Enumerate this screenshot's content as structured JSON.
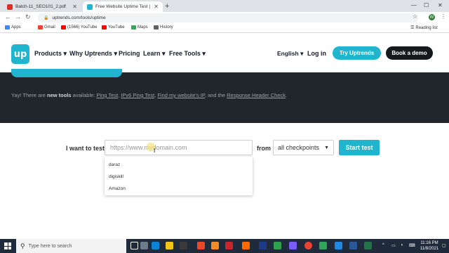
{
  "browser": {
    "tabs": [
      {
        "title": "Batch-11_SEO101_2.pdf",
        "active": false,
        "favicon_color": "#d93025"
      },
      {
        "title": "Free Website Uptime Test | Uptr",
        "active": true,
        "favicon_color": "#1fb5cf"
      }
    ],
    "url": "uptrends.com/tools/uptime",
    "profile_initial": "W",
    "bookmarks": [
      {
        "label": "Apps",
        "icon_color": "#4285f4"
      },
      {
        "label": "Gmail",
        "icon_color": "#ea4335"
      },
      {
        "label": "(1566) YouTube",
        "icon_color": "#ff0000"
      },
      {
        "label": "YouTube",
        "icon_color": "#ff0000"
      },
      {
        "label": "Maps",
        "icon_color": "#34a853"
      },
      {
        "label": "History",
        "icon_color": "#5f6368"
      }
    ],
    "reading_list": "Reading list"
  },
  "site": {
    "logo_text": "up",
    "nav": [
      "Products",
      "Why Uptrends",
      "Pricing",
      "Learn",
      "Free Tools"
    ],
    "language": "English",
    "login": "Log in",
    "try_button": "Try Uptrends",
    "demo_button": "Book a demo",
    "accent_color": "#1fb5cf"
  },
  "promo": {
    "prefix": "Yay! There are ",
    "bold": "new tools",
    "middle": " available: ",
    "links": [
      "Ping Test",
      "IPv6 Ping Test",
      "Find my website's IP"
    ],
    "and": ", and the ",
    "last_link": "Response Header Check",
    "suffix": "."
  },
  "form": {
    "label": "I want to test",
    "url_placeholder": "https://www.mydomain.com",
    "from_label": "from",
    "checkpoints": "all checkpoints",
    "start_button": "Start test",
    "suggestions": [
      "daraz",
      "digiskill",
      "Amazon"
    ]
  },
  "taskbar": {
    "search_placeholder": "Type here to search",
    "time": "11:16 PM",
    "date": "11/8/2021"
  }
}
